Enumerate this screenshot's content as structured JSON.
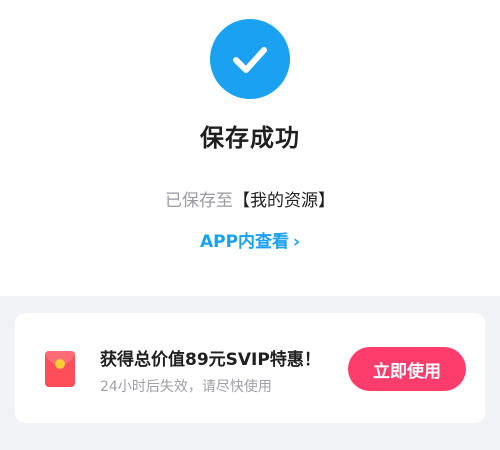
{
  "success": {
    "icon": "check-circle-icon",
    "title": "保存成功",
    "saved_prefix": "已保存至",
    "saved_destination": "【我的资源】",
    "app_link_label": "APP内查看",
    "app_link_chevron": "›"
  },
  "promo": {
    "icon": "red-envelope-icon",
    "title": "获得总价值89元SVIP特惠！",
    "subtitle": "24小时后失效，请尽快使用",
    "button_label": "立即使用"
  },
  "colors": {
    "accent_blue": "#1aa1f2",
    "button_pink": "#ff3d6c",
    "envelope_red": "#ff4d5a"
  }
}
